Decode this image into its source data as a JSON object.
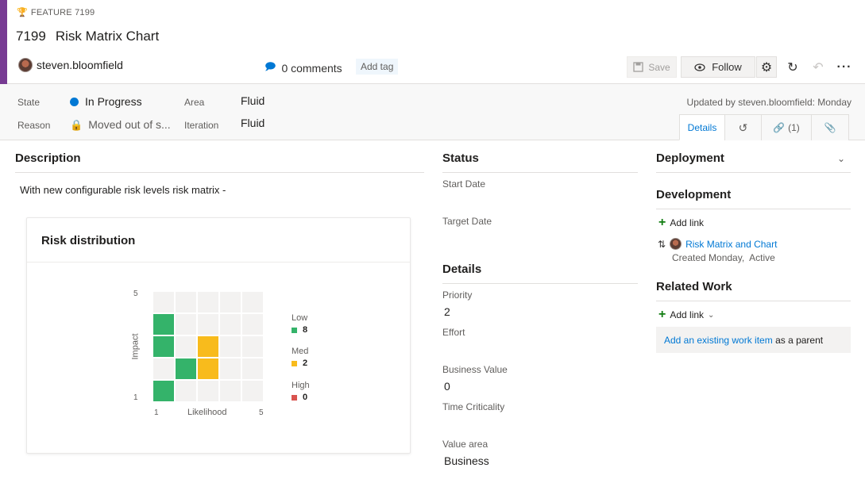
{
  "header": {
    "type_label": "FEATURE 7199",
    "id": "7199",
    "title": "Risk Matrix Chart",
    "assignee": "steven.bloomfield",
    "comments": "0 comments",
    "add_tag": "Add tag",
    "save_label": "Save",
    "follow_label": "Follow",
    "accent_color": "#773b93"
  },
  "fields": {
    "state_label": "State",
    "state_value": "In Progress",
    "reason_label": "Reason",
    "reason_value": "Moved out of s...",
    "area_label": "Area",
    "area_value": "Fluid",
    "iteration_label": "Iteration",
    "iteration_value": "Fluid",
    "updated": "Updated by steven.bloomfield: Monday"
  },
  "tabs": {
    "details": "Details",
    "links_count": "(1)"
  },
  "description": {
    "title": "Description",
    "text": "With new configurable risk levels risk matrix -"
  },
  "risk_card": {
    "title": "Risk distribution",
    "y_axis": "Impact",
    "x_axis": "Likelihood",
    "y_top": "5",
    "y_bottom": "1",
    "x_left": "1",
    "x_right": "5",
    "legend": [
      {
        "name": "Low",
        "value": "8",
        "color": "#34b36a"
      },
      {
        "name": "Med",
        "value": "2",
        "color": "#f8bb1c"
      },
      {
        "name": "High",
        "value": "0",
        "color": "#d9534f"
      }
    ]
  },
  "status": {
    "title": "Status",
    "start_date_label": "Start Date",
    "target_date_label": "Target Date"
  },
  "details": {
    "title": "Details",
    "priority_label": "Priority",
    "priority_value": "2",
    "effort_label": "Effort",
    "business_value_label": "Business Value",
    "business_value_value": "0",
    "time_criticality_label": "Time Criticality",
    "value_area_label": "Value area",
    "value_area_value": "Business"
  },
  "deployment": {
    "title": "Deployment"
  },
  "development": {
    "title": "Development",
    "add_link": "Add link",
    "linked_item": "Risk Matrix and Chart",
    "linked_meta": "Created Monday,  Active"
  },
  "related": {
    "title": "Related Work",
    "add_link": "Add link",
    "existing_link": "Add an existing work item",
    "existing_suffix": " as a parent"
  }
}
